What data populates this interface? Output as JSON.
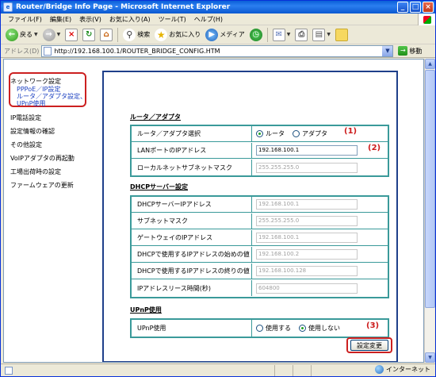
{
  "window": {
    "title": "Router/Bridge Info Page - Microsoft Internet Explorer",
    "icon": "ie-icon"
  },
  "menu": [
    "ファイル(F)",
    "編集(E)",
    "表示(V)",
    "お気に入り(A)",
    "ツール(T)",
    "ヘルプ(H)"
  ],
  "toolbar": {
    "back": "戻る",
    "search": "検索",
    "favorites": "お気に入り",
    "media": "メディア"
  },
  "address": {
    "label": "アドレス(D)",
    "url": "http://192.168.100.1/ROUTER_BRIDGE_CONFIG.HTM",
    "go": "移動"
  },
  "nav": {
    "network_settings": "ネットワーク設定",
    "sub_pppoe": "PPPoE／IP設定",
    "sub_router": "ルータ／アダプタ設定、",
    "sub_upnp": "UPnP使用",
    "items": [
      "IP電話設定",
      "設定情報の確認",
      "その他設定",
      "VoIPアダプタの再起動",
      "工場出荷時の設定",
      "ファームウェアの更新"
    ]
  },
  "section_router": {
    "title": "ルータ／アダプタ",
    "mode_label": "ルータ／アダプタ選択",
    "option_router": "ルータ",
    "option_adapter": "アダプタ",
    "lan_ip_label": "LANポートのIPアドレス",
    "lan_ip_value": "192.168.100.1",
    "subnet_label": "ローカルネットサブネットマスク",
    "subnet_value": "255.255.255.0"
  },
  "section_dhcp": {
    "title": "DHCPサーバー設定",
    "rows": [
      {
        "label": "DHCPサーバーIPアドレス",
        "value": "192.168.100.1"
      },
      {
        "label": "サブネットマスク",
        "value": "255.255.255.0"
      },
      {
        "label": "ゲートウェイのIPアドレス",
        "value": "192.168.100.1"
      },
      {
        "label": "DHCPで使用するIPアドレスの始めの値",
        "value": "192.168.100.2"
      },
      {
        "label": "DHCPで使用するIPアドレスの終りの値",
        "value": "192.168.100.128"
      },
      {
        "label": "IPアドレスリース時間(秒)",
        "value": "604800"
      }
    ]
  },
  "section_upnp": {
    "title": "UPnP使用",
    "label": "UPnP使用",
    "option_use": "使用する",
    "option_nouse": "使用しない"
  },
  "annotations": {
    "a1": "(1)",
    "a2": "(2)",
    "a3": "(3)"
  },
  "submit_label": "設定変更",
  "status": {
    "zone": "インターネット"
  }
}
